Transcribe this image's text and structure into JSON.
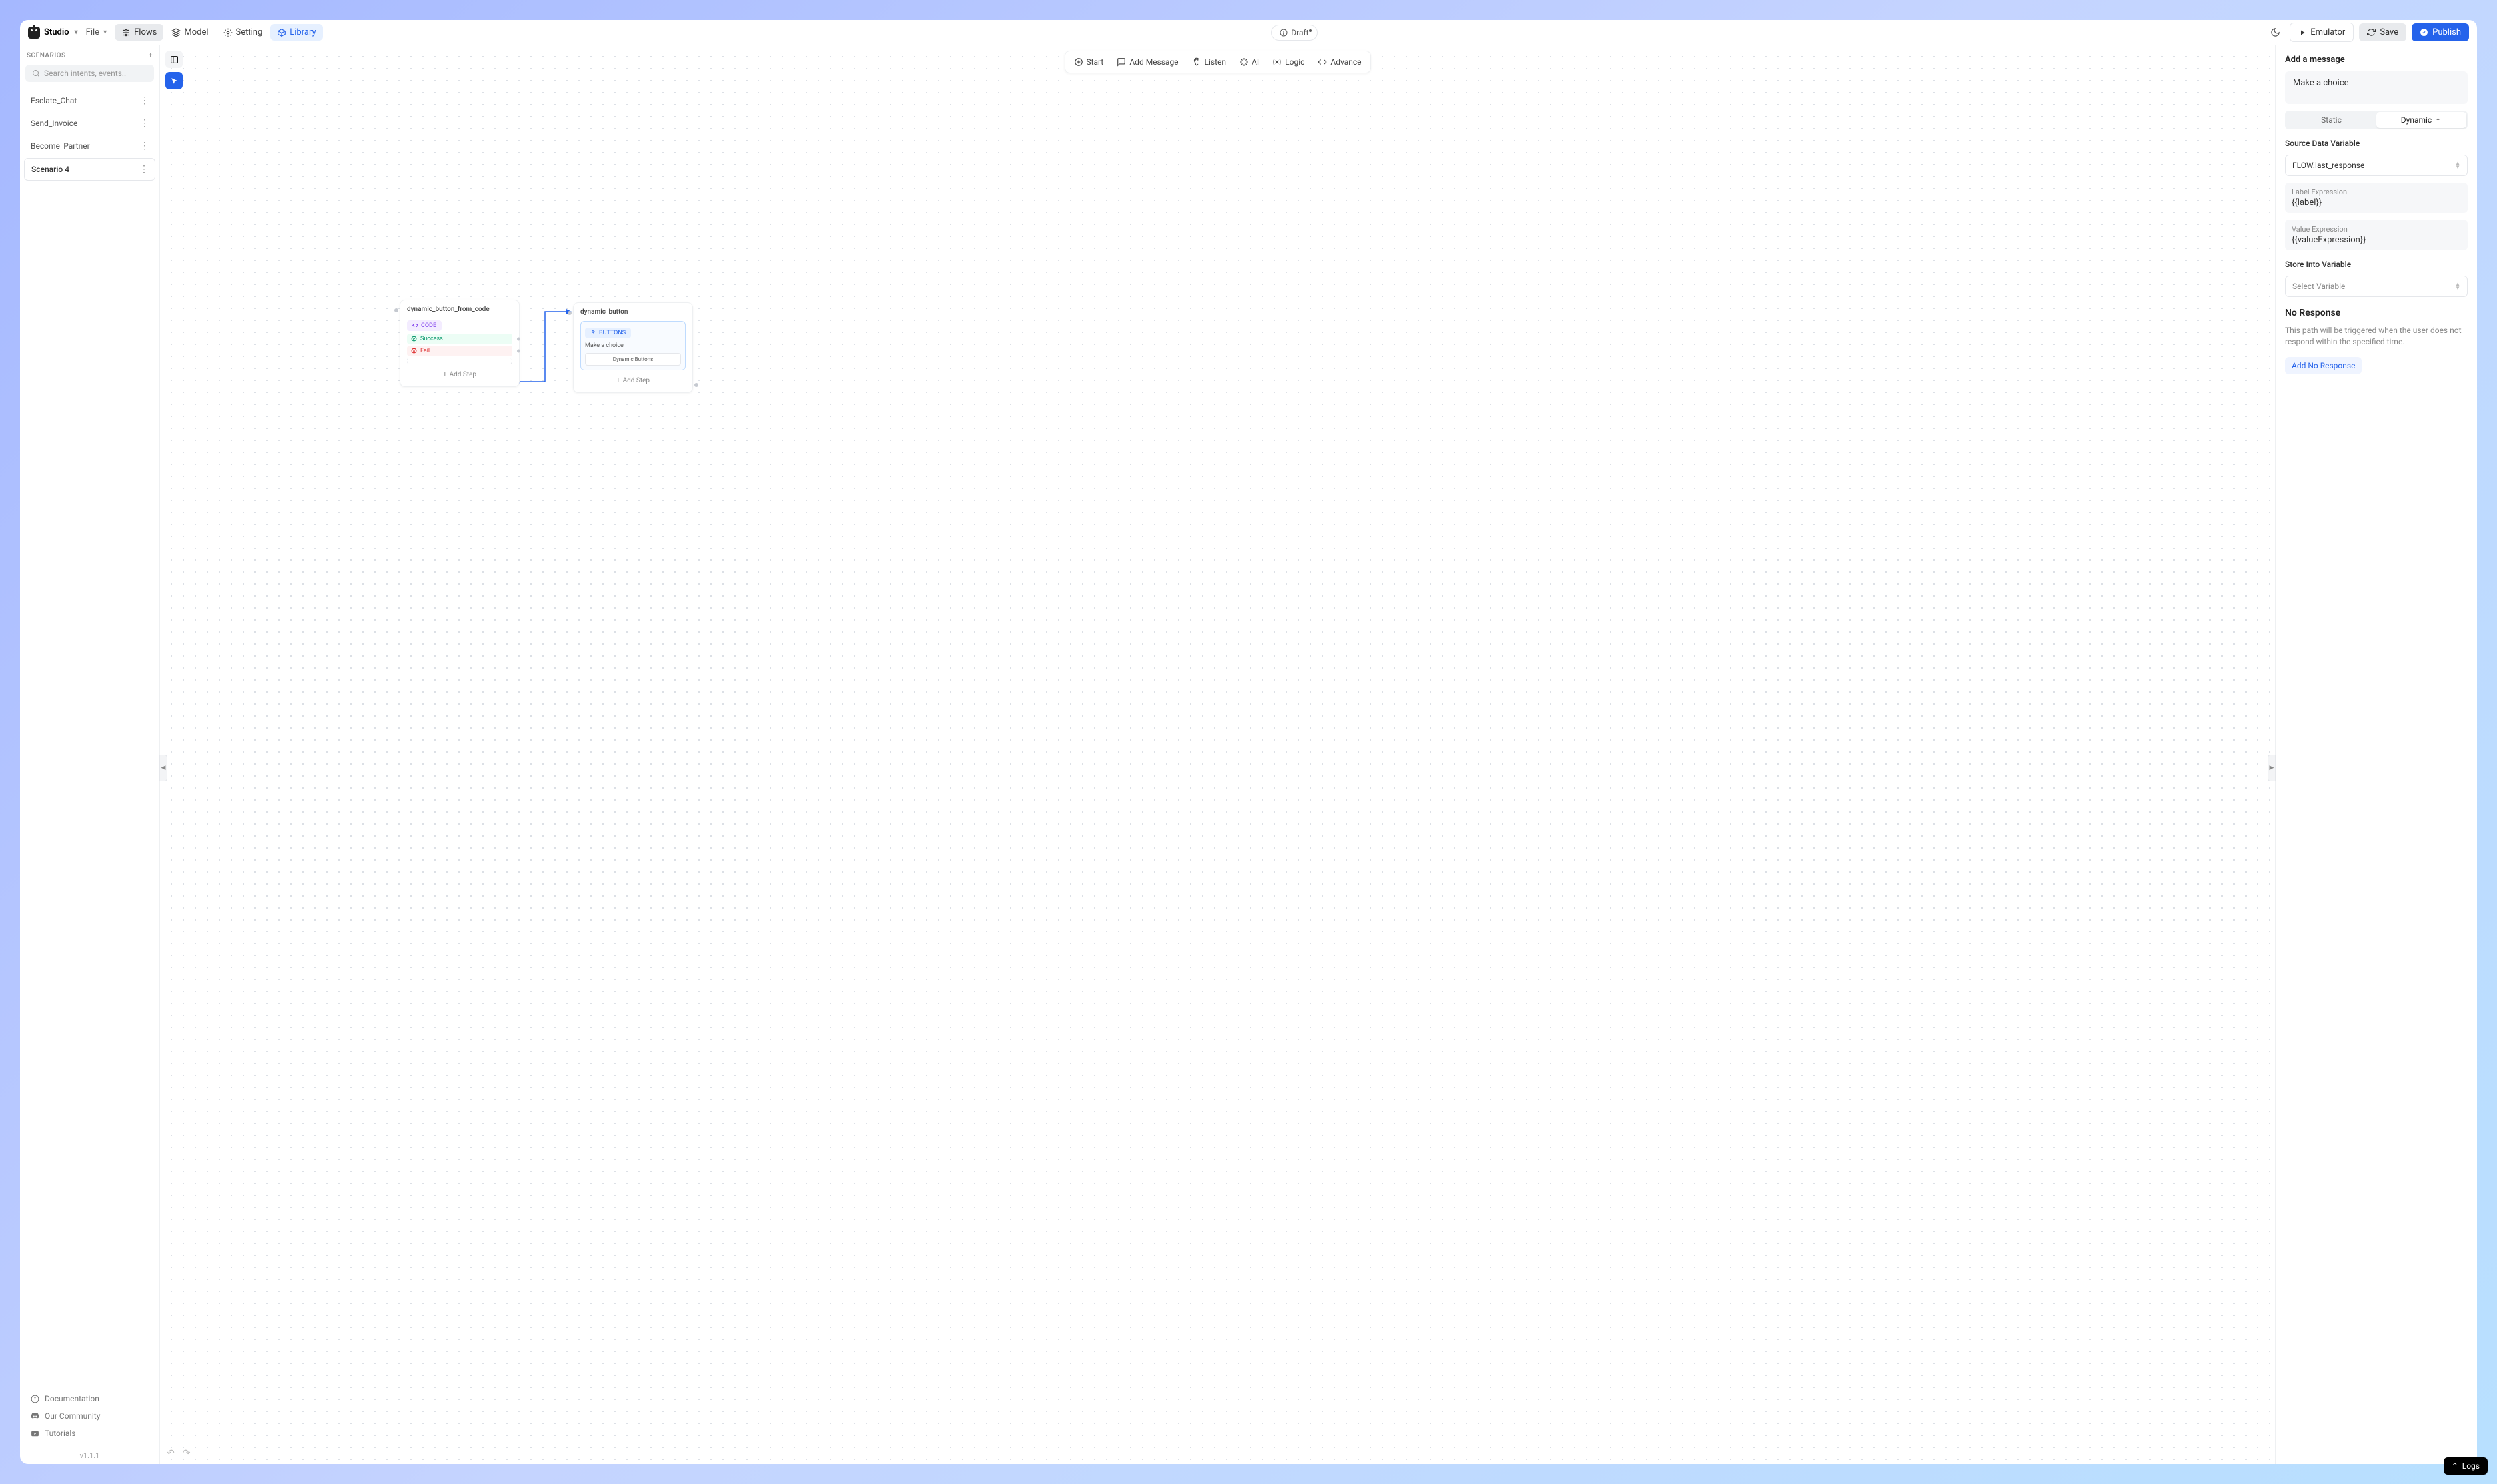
{
  "brand": "Studio",
  "menus": {
    "file": "File"
  },
  "nav": {
    "flows": "Flows",
    "model": "Model",
    "setting": "Setting",
    "library": "Library"
  },
  "draft": "Draft",
  "actions": {
    "emulator": "Emulator",
    "save": "Save",
    "publish": "Publish"
  },
  "sidebar": {
    "heading": "SCENARIOS",
    "search_placeholder": "Search intents, events..",
    "items": [
      "Esclate_Chat",
      "Send_Invoice",
      "Become_Partner",
      "Scenario 4"
    ],
    "links": {
      "docs": "Documentation",
      "community": "Our Community",
      "tutorials": "Tutorials"
    },
    "version": "v1.1.1"
  },
  "toolbar": {
    "start": "Start",
    "add_message": "Add Message",
    "listen": "Listen",
    "ai": "AI",
    "logic": "Logic",
    "advance": "Advance"
  },
  "node1": {
    "title": "dynamic_button_from_code",
    "chip": "CODE",
    "success": "Success",
    "fail": "Fail",
    "add": "Add Step"
  },
  "node2": {
    "title": "dynamic_button",
    "chip": "BUTTONS",
    "prompt": "Make a choice",
    "dynbtn": "Dynamic Buttons",
    "add": "Add Step"
  },
  "panel": {
    "add_msg_title": "Add a message",
    "message_text": "Make a choice",
    "tabs": {
      "static": "Static",
      "dynamic": "Dynamic"
    },
    "source_label": "Source Data Variable",
    "source_value": "FLOW.last_response",
    "label_expr_label": "Label Expression",
    "label_expr_value": "{{label}}",
    "value_expr_label": "Value Expression",
    "value_expr_value": "{{valueExpression}}",
    "store_label": "Store Into Variable",
    "store_placeholder": "Select Variable",
    "noresp_title": "No Response",
    "noresp_desc": "This path will be triggered when the user does not respond within the specified time.",
    "noresp_btn": "Add No Response"
  },
  "logs": "Logs"
}
